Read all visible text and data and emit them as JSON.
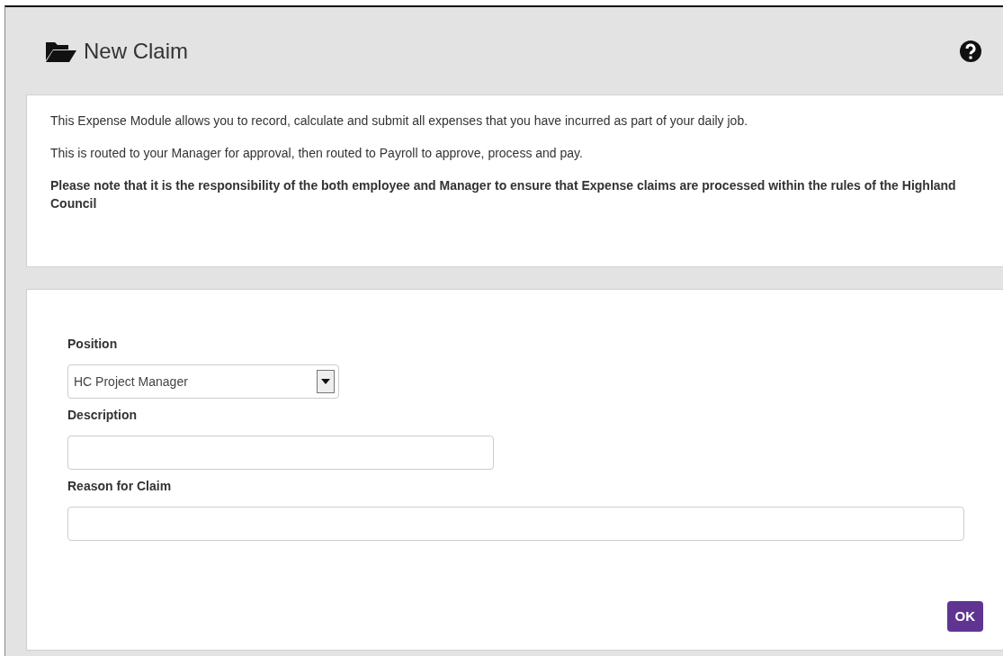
{
  "header": {
    "title": "New Claim"
  },
  "intro": [
    {
      "text": "This Expense Module allows you to record, calculate and submit all expenses that you have incurred as part of your daily job.",
      "bold": false
    },
    {
      "text": "This is routed to your Manager for approval, then routed to Payroll to approve, process and pay.",
      "bold": false
    },
    {
      "text": "Please note that it is the responsibility of the both employee and Manager to ensure that Expense claims are processed within the rules of the Highland Council",
      "bold": true
    }
  ],
  "form": {
    "fields": [
      {
        "label": "Position",
        "kind": "select",
        "value": "HC Project Manager"
      },
      {
        "label": "Description",
        "kind": "short"
      },
      {
        "label": "Reason for Claim",
        "kind": "wide"
      }
    ],
    "button": "OK"
  }
}
